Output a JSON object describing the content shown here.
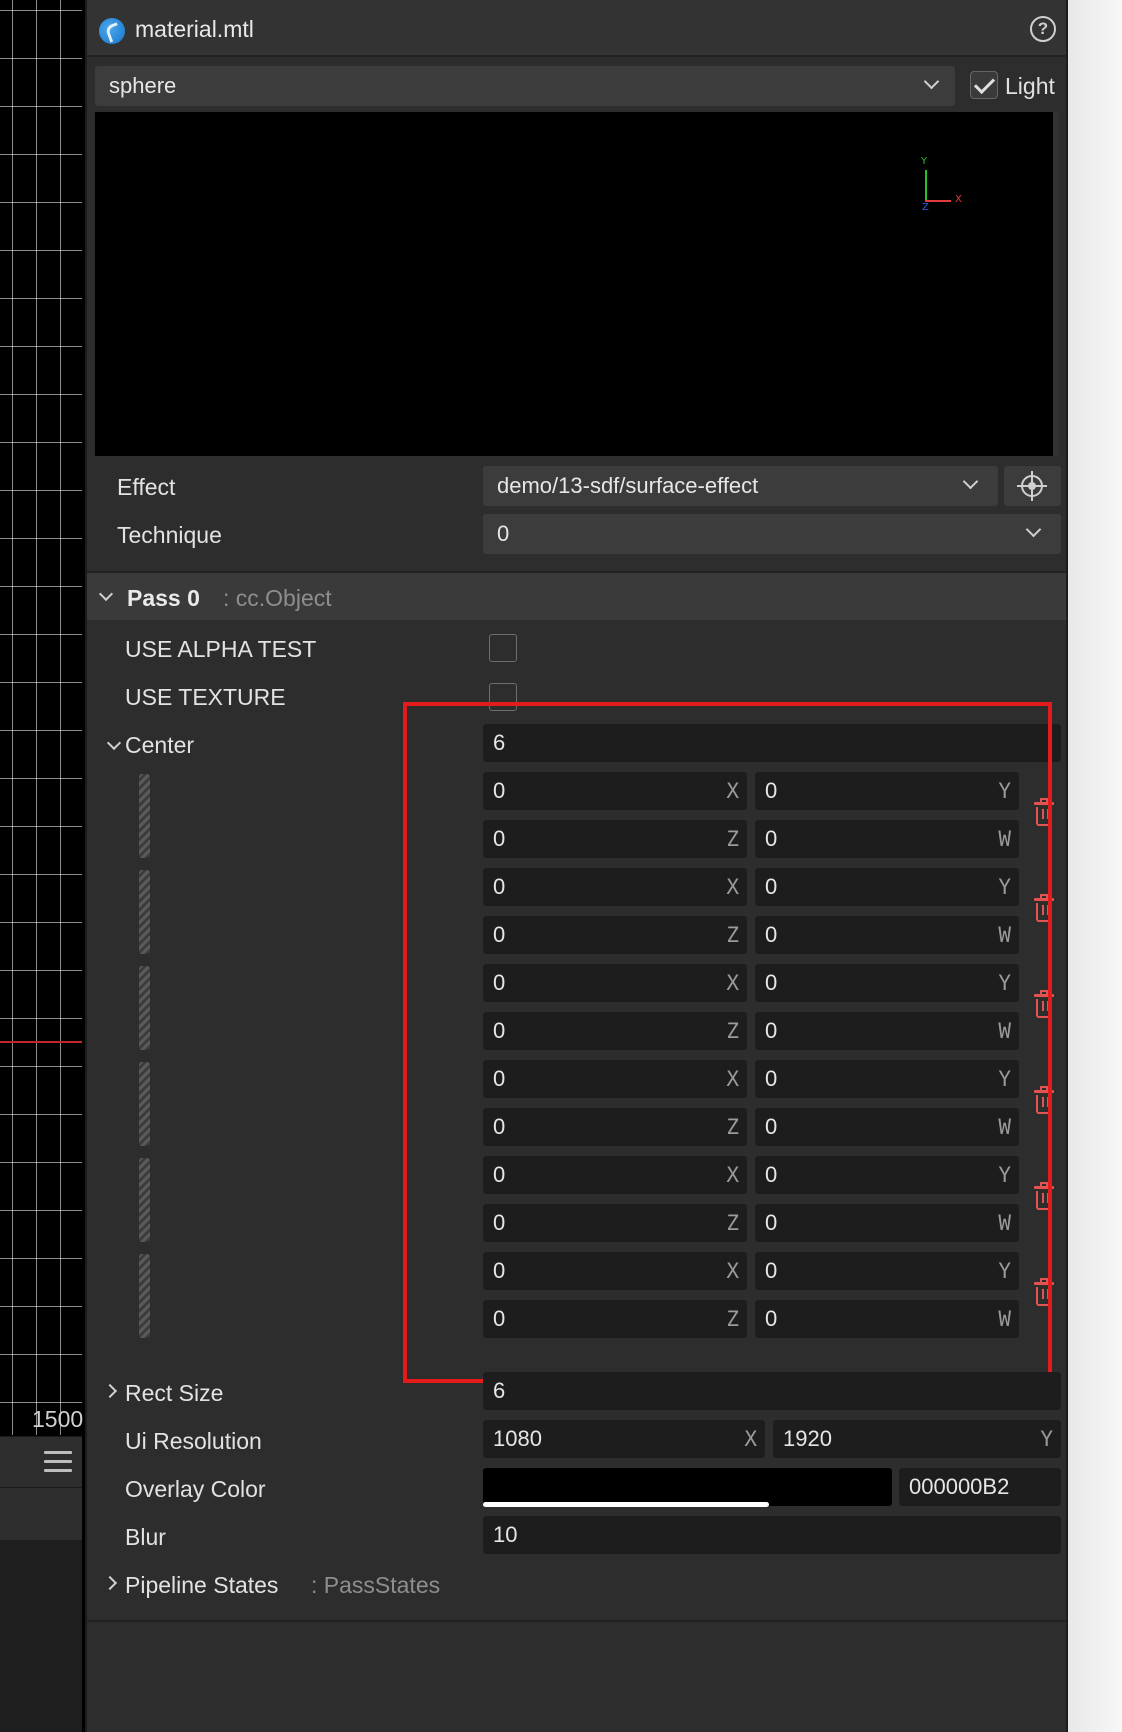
{
  "scene": {
    "scale_label": "1500"
  },
  "header": {
    "title": "material.mtl"
  },
  "preview": {
    "shape_selected": "sphere",
    "light_label": "Light",
    "light_checked": true,
    "gizmo": {
      "y": "Y",
      "x": "X",
      "z": "Z"
    }
  },
  "effect": {
    "label": "Effect",
    "value": "demo/13-sdf/surface-effect"
  },
  "technique": {
    "label": "Technique",
    "value": "0"
  },
  "pass": {
    "title": "Pass 0",
    "type": ": cc.Object",
    "use_alpha_test": {
      "label": "USE ALPHA TEST",
      "checked": false
    },
    "use_texture": {
      "label": "USE TEXTURE",
      "checked": false
    },
    "center": {
      "label": "Center",
      "count": "6",
      "items": [
        {
          "x": "0",
          "y": "0",
          "z": "0",
          "w": "0"
        },
        {
          "x": "0",
          "y": "0",
          "z": "0",
          "w": "0"
        },
        {
          "x": "0",
          "y": "0",
          "z": "0",
          "w": "0"
        },
        {
          "x": "0",
          "y": "0",
          "z": "0",
          "w": "0"
        },
        {
          "x": "0",
          "y": "0",
          "z": "0",
          "w": "0"
        },
        {
          "x": "0",
          "y": "0",
          "z": "0",
          "w": "0"
        }
      ],
      "axis_labels": {
        "x": "X",
        "y": "Y",
        "z": "Z",
        "w": "W"
      }
    },
    "rect_size": {
      "label": "Rect Size",
      "count": "6"
    },
    "ui_resolution": {
      "label": "Ui Resolution",
      "x": "1080",
      "y": "1920",
      "x_axis": "X",
      "y_axis": "Y"
    },
    "overlay_color": {
      "label": "Overlay Color",
      "hex": "000000B2",
      "alpha": 0.7
    },
    "blur": {
      "label": "Blur",
      "value": "10"
    },
    "pipeline_states": {
      "label": "Pipeline States",
      "type": ": PassStates"
    }
  },
  "colors": {
    "highlight": "#e41b1b",
    "delete_icon": "#e45353",
    "panel_bg": "#2d2d2d"
  }
}
